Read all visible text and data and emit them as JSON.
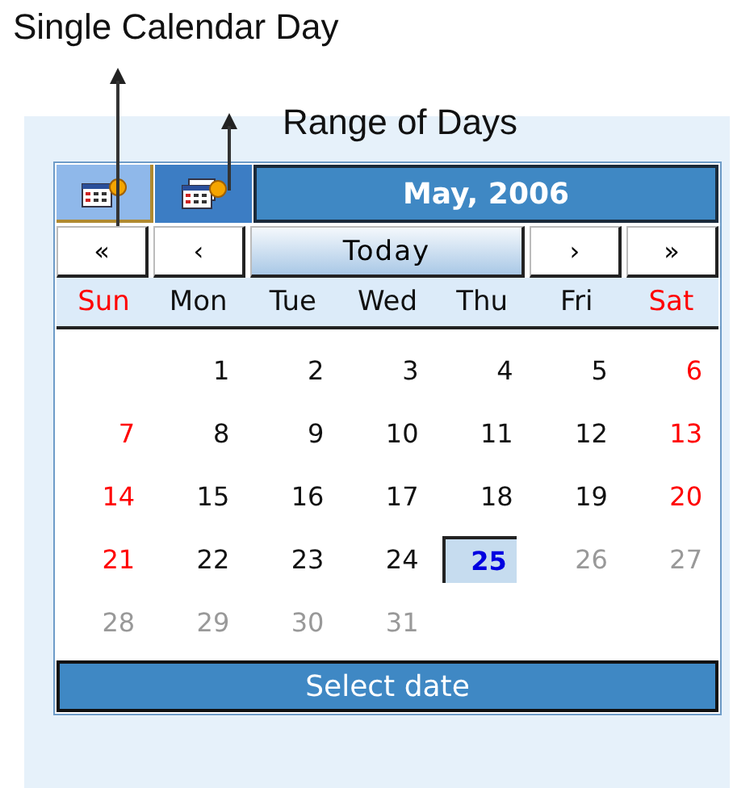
{
  "annotations": [
    {
      "label": "Single Calendar Day"
    },
    {
      "label": "Range of Days"
    }
  ],
  "modes": [
    {
      "selected": true
    },
    {
      "selected": false
    }
  ],
  "title": "May, 2006",
  "nav": {
    "first": "«",
    "prev": "‹",
    "today": "Today",
    "next": "›",
    "last": "»"
  },
  "weekdays": [
    {
      "label": "Sun",
      "weekend": true
    },
    {
      "label": "Mon",
      "weekend": false
    },
    {
      "label": "Tue",
      "weekend": false
    },
    {
      "label": "Wed",
      "weekend": false
    },
    {
      "label": "Thu",
      "weekend": false
    },
    {
      "label": "Fri",
      "weekend": false
    },
    {
      "label": "Sat",
      "weekend": true
    }
  ],
  "weeks": [
    [
      {
        "label": "1",
        "selected": false,
        "disabled": false
      },
      {
        "label": "2",
        "selected": false,
        "disabled": false
      },
      {
        "label": "3",
        "selected": false,
        "disabled": false
      },
      {
        "label": "4",
        "selected": false,
        "disabled": false
      },
      {
        "label": "5",
        "selected": false,
        "disabled": false
      },
      {
        "label": "6",
        "selected": false,
        "disabled": false
      }
    ],
    [
      {
        "label": "7",
        "selected": false,
        "disabled": false
      },
      {
        "label": "8",
        "selected": false,
        "disabled": false
      },
      {
        "label": "9",
        "selected": false,
        "disabled": false
      },
      {
        "label": "10",
        "selected": false,
        "disabled": false
      },
      {
        "label": "11",
        "selected": false,
        "disabled": false
      },
      {
        "label": "12",
        "selected": false,
        "disabled": false
      },
      {
        "label": "13",
        "selected": false,
        "disabled": false
      }
    ],
    [
      {
        "label": "14",
        "selected": false,
        "disabled": false
      },
      {
        "label": "15",
        "selected": false,
        "disabled": false
      },
      {
        "label": "16",
        "selected": false,
        "disabled": false
      },
      {
        "label": "17",
        "selected": false,
        "disabled": false
      },
      {
        "label": "18",
        "selected": false,
        "disabled": false
      },
      {
        "label": "19",
        "selected": false,
        "disabled": false
      },
      {
        "label": "20",
        "selected": false,
        "disabled": false
      }
    ],
    [
      {
        "label": "21",
        "selected": false,
        "disabled": false
      },
      {
        "label": "22",
        "selected": false,
        "disabled": false
      },
      {
        "label": "23",
        "selected": false,
        "disabled": false
      },
      {
        "label": "24",
        "selected": false,
        "disabled": false
      },
      {
        "label": "25",
        "selected": true,
        "disabled": false
      },
      {
        "label": "26",
        "selected": false,
        "disabled": true
      },
      {
        "label": "27",
        "selected": false,
        "disabled": true
      }
    ],
    [
      {
        "label": "28",
        "selected": false,
        "disabled": true
      },
      {
        "label": "29",
        "selected": false,
        "disabled": true
      },
      {
        "label": "30",
        "selected": false,
        "disabled": true
      },
      {
        "label": "31",
        "selected": false,
        "disabled": true
      }
    ]
  ],
  "select_button": "Select date"
}
